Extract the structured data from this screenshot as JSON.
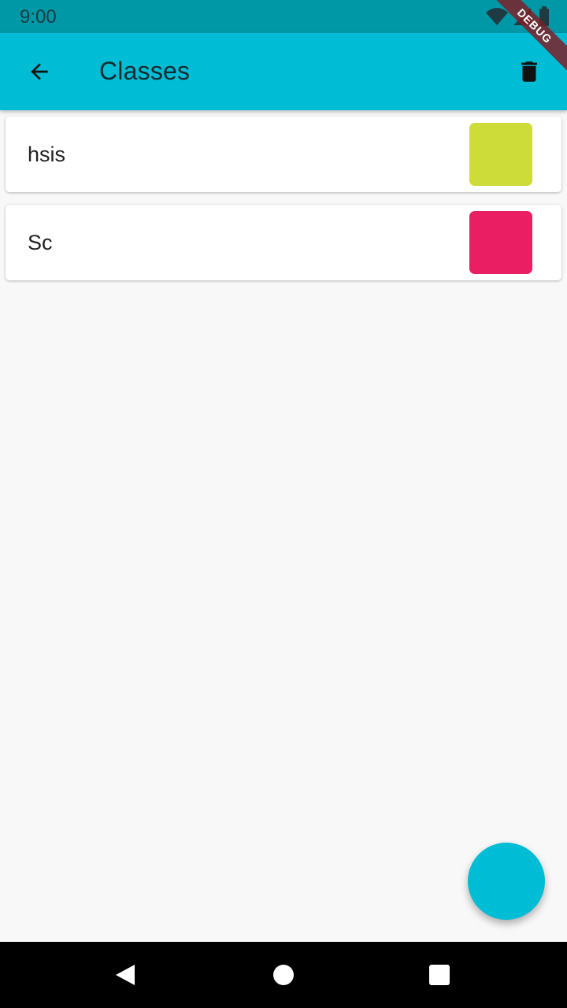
{
  "status_bar": {
    "time": "9:00",
    "icons": [
      "wifi-icon",
      "signal-icon",
      "battery-icon"
    ]
  },
  "debug_banner": "DEBUG",
  "app_bar": {
    "title": "Classes",
    "back_icon": "arrow-back-icon",
    "delete_icon": "trash-icon",
    "background": "#00bcd4"
  },
  "classes": [
    {
      "name": "hsis",
      "color": "#cddc39"
    },
    {
      "name": "Sc",
      "color": "#e91e63"
    }
  ],
  "fab": {
    "color": "#00bcd4"
  },
  "nav_bar": {
    "icons": [
      "back-triangle-icon",
      "home-circle-icon",
      "recents-square-icon"
    ]
  }
}
